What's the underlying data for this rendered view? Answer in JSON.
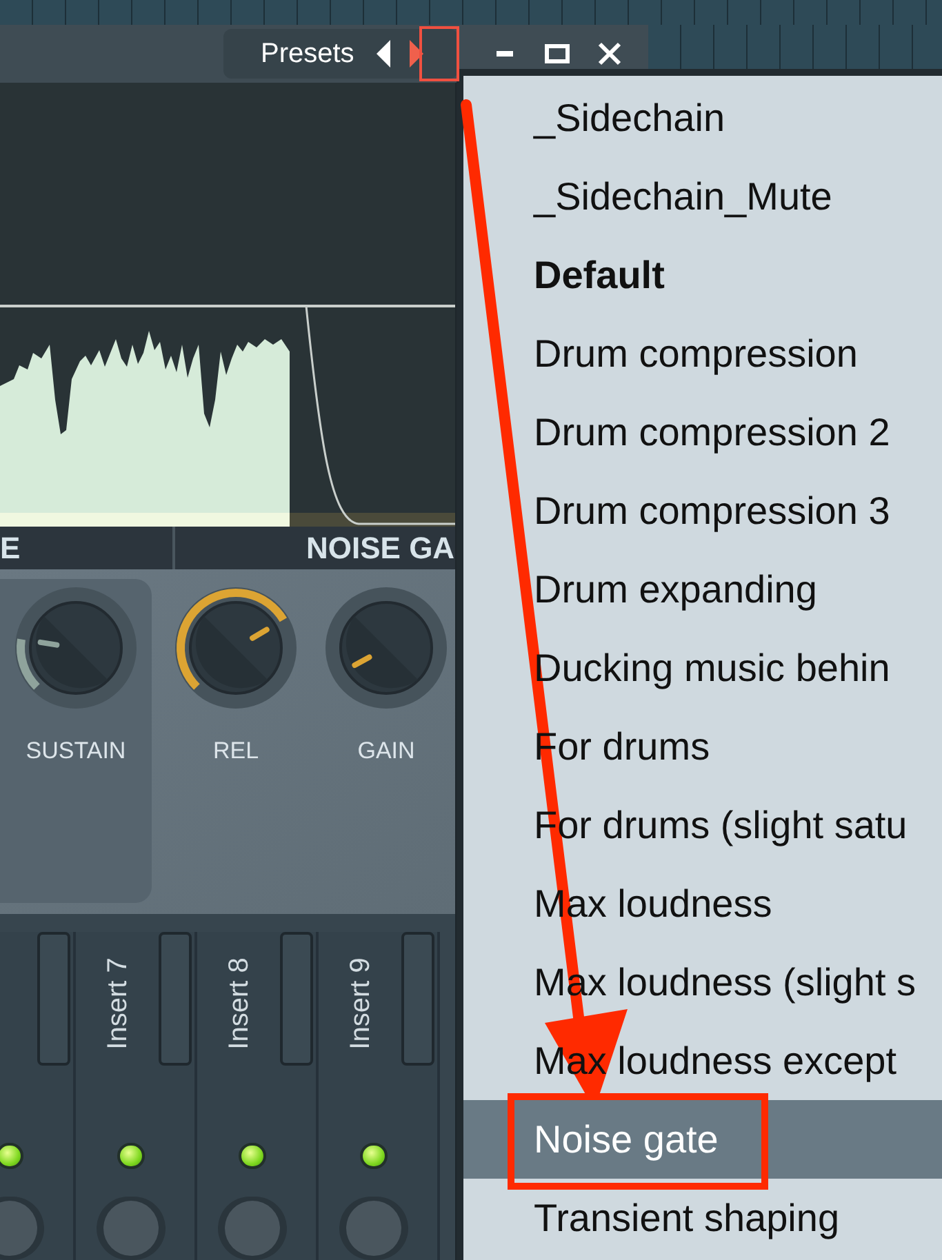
{
  "presets": {
    "label": "Presets"
  },
  "preset_nav": [
    {
      "kind": "prev",
      "selected": false
    },
    {
      "kind": "next",
      "selected": true
    }
  ],
  "section_headers": [
    "E",
    "NOISE GA"
  ],
  "knobs": [
    {
      "label": "SUSTAIN",
      "color": "#8fa39c"
    },
    {
      "label": "REL",
      "color": "#dca433"
    },
    {
      "label": "GAIN",
      "color": "#dca433"
    }
  ],
  "mixer_tracks": [
    {
      "led_on": true
    },
    {
      "label": "Insert 7",
      "led_on": true
    },
    {
      "label": "Insert 8",
      "led_on": true
    },
    {
      "label": "Insert 9",
      "led_on": true
    }
  ],
  "preset_menu": {
    "items": [
      {
        "label": "_Sidechain",
        "bold": false,
        "selected": false
      },
      {
        "label": "_Sidechain_Mute",
        "bold": false,
        "selected": false
      },
      {
        "label": "Default",
        "bold": true,
        "selected": false
      },
      {
        "label": "Drum compression",
        "bold": false,
        "selected": false
      },
      {
        "label": "Drum compression 2",
        "bold": false,
        "selected": false
      },
      {
        "label": "Drum compression 3",
        "bold": false,
        "selected": false
      },
      {
        "label": "Drum expanding",
        "bold": false,
        "selected": false
      },
      {
        "label": "Ducking music behin",
        "bold": false,
        "selected": false
      },
      {
        "label": "For drums",
        "bold": false,
        "selected": false
      },
      {
        "label": "For drums (slight satu",
        "bold": false,
        "selected": false
      },
      {
        "label": "Max loudness",
        "bold": false,
        "selected": false
      },
      {
        "label": "Max loudness (slight s",
        "bold": false,
        "selected": false
      },
      {
        "label": "Max loudness except",
        "bold": false,
        "selected": false
      },
      {
        "label": "Noise gate",
        "bold": false,
        "selected": true
      },
      {
        "label": "Transient shaping",
        "bold": false,
        "selected": false
      }
    ]
  }
}
